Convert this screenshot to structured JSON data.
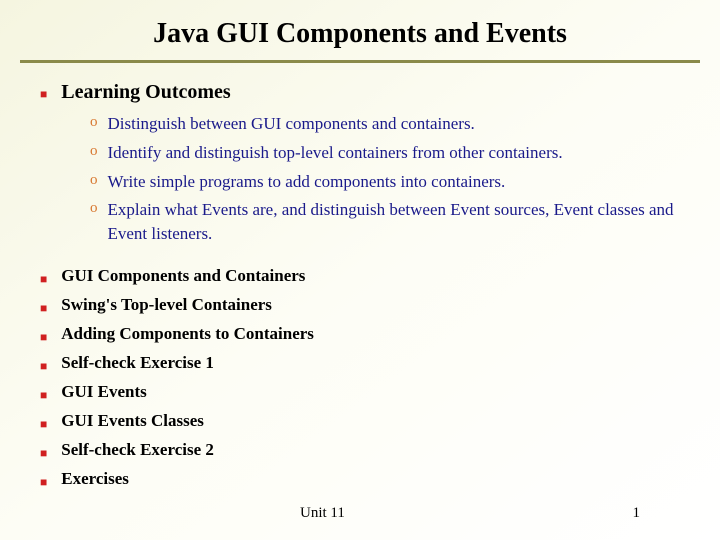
{
  "title": "Java GUI Components and Events",
  "heading": "Learning Outcomes",
  "outcomes": [
    "Distinguish between GUI components and containers.",
    "Identify and distinguish top-level containers from other containers.",
    "Write simple programs to add components into containers.",
    "Explain what Events are, and distinguish between Event sources, Event classes and Event listeners."
  ],
  "topics": [
    "GUI Components and Containers",
    "Swing's Top-level Containers",
    "Adding Components to Containers",
    "Self-check Exercise 1",
    "GUI Events",
    "GUI Events Classes",
    "Self-check Exercise 2",
    "Exercises"
  ],
  "footer": {
    "unit": "Unit 11",
    "page": "1"
  }
}
